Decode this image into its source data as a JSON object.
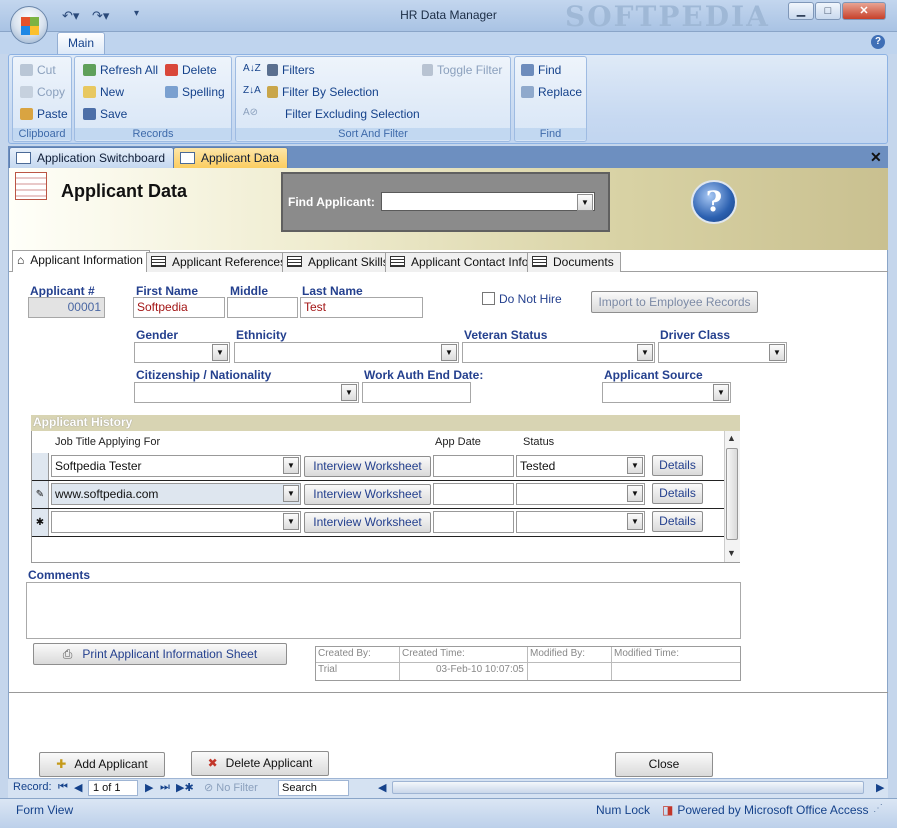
{
  "window": {
    "title": "HR Data Manager",
    "watermark": "SOFTPEDIA",
    "controls": {
      "minimize": "▁",
      "maximize": "□",
      "close": "✕"
    }
  },
  "ribbon": {
    "tab": "Main",
    "groups": {
      "clipboard": {
        "label": "Clipboard",
        "cut": "Cut",
        "copy": "Copy",
        "paste": "Paste"
      },
      "records": {
        "label": "Records",
        "refresh_all": "Refresh All",
        "new": "New",
        "save": "Save",
        "delete": "Delete",
        "spelling": "Spelling"
      },
      "sort_filter": {
        "label": "Sort And Filter",
        "filters": "Filters",
        "filter_by_selection": "Filter By Selection",
        "filter_excluding": "Filter Excluding Selection",
        "toggle_filter": "Toggle Filter"
      },
      "find": {
        "label": "Find",
        "find": "Find",
        "replace": "Replace"
      }
    }
  },
  "doc_tabs": [
    "Application Switchboard",
    "Applicant Data"
  ],
  "header": {
    "title": "Applicant Data",
    "find_label": "Find Applicant:",
    "find_value": ""
  },
  "form_tabs": [
    "Applicant Information",
    "Applicant References",
    "Applicant Skills",
    "Applicant Contact Info",
    "Documents"
  ],
  "fields": {
    "applicant_num": {
      "label": "Applicant #",
      "value": "00001"
    },
    "first_name": {
      "label": "First Name",
      "value": "Softpedia"
    },
    "middle": {
      "label": "Middle",
      "value": ""
    },
    "last_name": {
      "label": "Last Name",
      "value": "Test"
    },
    "do_not_hire": {
      "label": "Do Not Hire",
      "checked": false
    },
    "import_btn": "Import to Employee Records",
    "gender": {
      "label": "Gender",
      "value": ""
    },
    "ethnicity": {
      "label": "Ethnicity",
      "value": ""
    },
    "veteran": {
      "label": "Veteran Status",
      "value": ""
    },
    "driver_class": {
      "label": "Driver Class",
      "value": ""
    },
    "citizenship": {
      "label": "Citizenship / Nationality",
      "value": ""
    },
    "work_auth": {
      "label": "Work Auth End Date:",
      "value": ""
    },
    "source": {
      "label": "Applicant Source",
      "value": ""
    }
  },
  "history": {
    "title": "Applicant History",
    "columns": {
      "job": "Job Title Applying For",
      "date": "App Date",
      "status": "Status"
    },
    "interview_label": "Interview Worksheet",
    "details_label": "Details",
    "rows": [
      {
        "selector": "",
        "job": "Softpedia Tester",
        "date": "",
        "status": "Tested"
      },
      {
        "selector": "✎",
        "job": "www.softpedia.com",
        "date": "",
        "status": ""
      },
      {
        "selector": "✱",
        "job": "",
        "date": "",
        "status": ""
      }
    ]
  },
  "comments": {
    "label": "Comments",
    "value": ""
  },
  "print_btn": "Print Applicant Information Sheet",
  "audit": {
    "created_by_label": "Created By:",
    "created_by": "Trial",
    "created_time_label": "Created Time:",
    "created_time": "03-Feb-10 10:07:05",
    "modified_by_label": "Modified By:",
    "modified_by": "",
    "modified_time_label": "Modified Time:",
    "modified_time": ""
  },
  "buttons": {
    "add": "Add Applicant",
    "delete": "Delete Applicant",
    "close": "Close"
  },
  "record_nav": {
    "label": "Record:",
    "position": "1 of 1",
    "filter": "No Filter",
    "search": "Search"
  },
  "status": {
    "view": "Form View",
    "numlock": "Num Lock",
    "powered": "Powered by Microsoft Office Access"
  }
}
